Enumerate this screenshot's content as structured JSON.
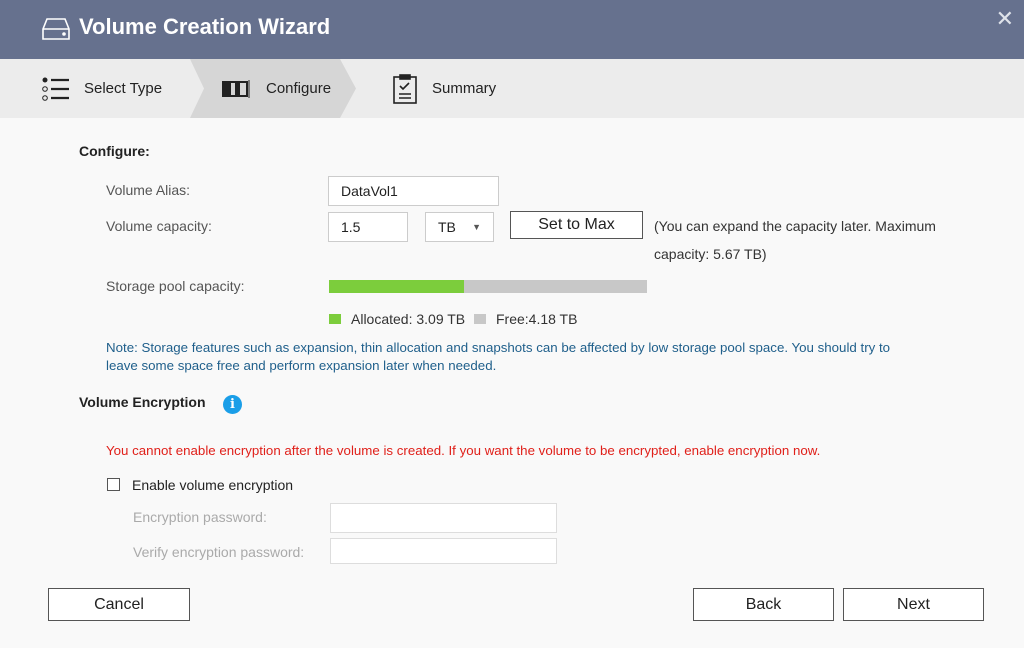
{
  "window": {
    "title": "Volume Creation Wizard"
  },
  "steps": [
    {
      "label": "Select Type"
    },
    {
      "label": "Configure",
      "active": true
    },
    {
      "label": "Summary"
    }
  ],
  "configure": {
    "heading": "Configure:",
    "alias_label": "Volume Alias:",
    "alias_value": "DataVol1",
    "capacity_label": "Volume capacity:",
    "capacity_value": "1.5",
    "unit": "TB",
    "set_max": "Set to Max",
    "capacity_hint_1": "(You can expand the capacity later. Maximum",
    "capacity_hint_2": "capacity: 5.67 TB)",
    "pool_label": "Storage pool capacity:",
    "pool_allocated_percent": 42.5,
    "allocated_label": "Allocated:  3.09 TB",
    "free_label": "Free:4.18 TB",
    "note_1": "Note: Storage features such as expansion, thin allocation and snapshots can be affected by low storage pool space. You should try to",
    "note_2": "leave some space free and perform expansion later when needed."
  },
  "encryption": {
    "heading": "Volume Encryption",
    "warning": "You cannot enable encryption after the volume is created. If you want the volume to be encrypted, enable encryption now.",
    "enable_label": "Enable volume encryption",
    "enabled": false,
    "password_label": "Encryption password:",
    "verify_label": "Verify encryption password:"
  },
  "footer": {
    "cancel": "Cancel",
    "back": "Back",
    "next": "Next"
  },
  "colors": {
    "titlebar": "#66718e",
    "allocated": "#7ccd3c",
    "free": "#c8c8c8",
    "note": "#1f5f8b",
    "warning": "#e0201a",
    "info": "#1a9ee8"
  }
}
